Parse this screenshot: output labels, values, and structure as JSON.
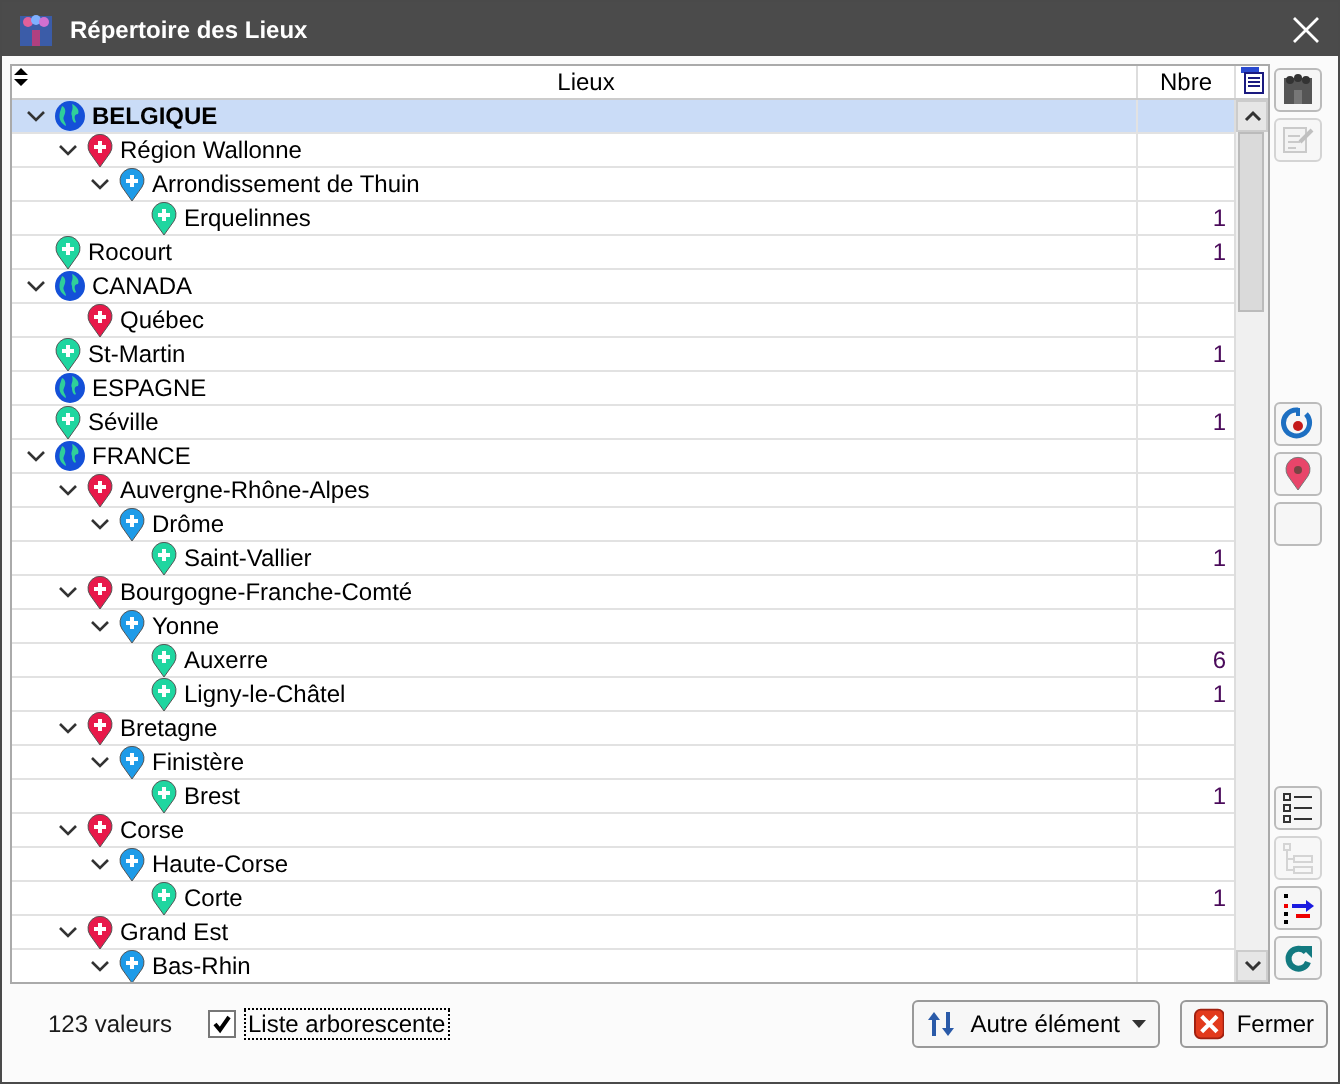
{
  "window": {
    "title": "Répertoire des Lieux"
  },
  "table": {
    "columns": [
      "Lieux",
      "Nbre"
    ],
    "rows": [
      {
        "kind": "country",
        "name": "BELGIQUE",
        "selected": true,
        "expanded": true,
        "children": [
          {
            "kind": "region",
            "name": "Région Wallonne",
            "selected": false,
            "expanded": true,
            "children": [
              {
                "kind": "department",
                "name": "Arrondissement de Thuin",
                "selected": false,
                "expanded": true,
                "children": [
                  {
                    "kind": "city",
                    "name": "Erquelinnes",
                    "count": "1",
                    "selected": false
                  }
                ]
              }
            ]
          }
        ]
      },
      {
        "kind": "city",
        "name": "Rocourt",
        "count": "1",
        "selected": false
      },
      {
        "kind": "country",
        "name": "CANADA",
        "selected": false,
        "expanded": true,
        "children": [
          {
            "kind": "region",
            "name": "Québec",
            "selected": false
          }
        ]
      },
      {
        "kind": "city",
        "name": "St-Martin",
        "count": "1",
        "selected": false
      },
      {
        "kind": "country",
        "name": "ESPAGNE",
        "selected": false
      },
      {
        "kind": "city",
        "name": "Séville",
        "count": "1",
        "selected": false
      },
      {
        "kind": "country",
        "name": "FRANCE",
        "selected": false,
        "expanded": true,
        "children": [
          {
            "kind": "region",
            "name": "Auvergne-Rhône-Alpes",
            "selected": false,
            "expanded": true,
            "children": [
              {
                "kind": "department",
                "name": "Drôme",
                "selected": false,
                "expanded": true,
                "children": [
                  {
                    "kind": "city",
                    "name": "Saint-Vallier",
                    "count": "1",
                    "selected": false
                  }
                ]
              }
            ]
          },
          {
            "kind": "region",
            "name": "Bourgogne-Franche-Comté",
            "selected": false,
            "expanded": true,
            "children": [
              {
                "kind": "department",
                "name": "Yonne",
                "selected": false,
                "expanded": true,
                "children": [
                  {
                    "kind": "city",
                    "name": "Auxerre",
                    "count": "6",
                    "selected": false
                  },
                  {
                    "kind": "city",
                    "name": "Ligny-le-Châtel",
                    "count": "1",
                    "selected": false
                  }
                ]
              }
            ]
          },
          {
            "kind": "region",
            "name": "Bretagne",
            "selected": false,
            "expanded": true,
            "children": [
              {
                "kind": "department",
                "name": "Finistère",
                "selected": false,
                "expanded": true,
                "children": [
                  {
                    "kind": "city",
                    "name": "Brest",
                    "count": "1",
                    "selected": false
                  }
                ]
              }
            ]
          },
          {
            "kind": "region",
            "name": "Corse",
            "selected": false,
            "expanded": true,
            "children": [
              {
                "kind": "department",
                "name": "Haute-Corse",
                "selected": false,
                "expanded": true,
                "children": [
                  {
                    "kind": "city",
                    "name": "Corte",
                    "count": "1",
                    "selected": false
                  }
                ]
              }
            ]
          },
          {
            "kind": "region",
            "name": "Grand Est",
            "selected": false,
            "expanded": true,
            "children": [
              {
                "kind": "department",
                "name": "Bas-Rhin",
                "selected": false,
                "expanded": true
              }
            ]
          }
        ]
      }
    ]
  },
  "toolbar": {
    "groups": [
      [
        {
          "kind": "people",
          "disabled": false
        },
        {
          "kind": "edit",
          "disabled": true
        }
      ],
      [
        {
          "kind": "target",
          "disabled": false
        },
        {
          "kind": "pin",
          "disabled": false
        },
        {
          "kind": "blank",
          "disabled": false
        }
      ],
      [
        {
          "kind": "list",
          "disabled": false
        },
        {
          "kind": "tree",
          "disabled": true
        },
        {
          "kind": "move",
          "disabled": false
        },
        {
          "kind": "refresh",
          "disabled": false
        }
      ]
    ]
  },
  "footer": {
    "count": "123 valeurs",
    "tree_checkbox": {
      "label": "Liste arborescente",
      "checked": true
    },
    "buttons": [
      {
        "kind": "menu",
        "label": "Autre élément"
      },
      {
        "kind": "close",
        "label": "Fermer"
      }
    ]
  }
}
